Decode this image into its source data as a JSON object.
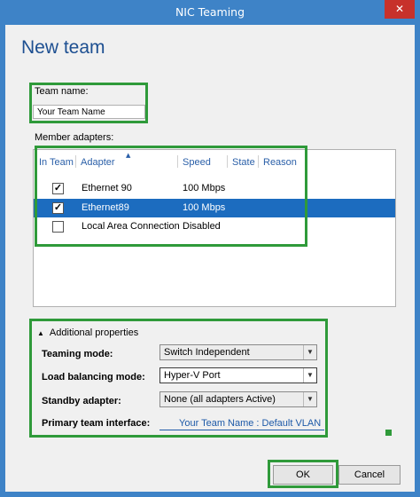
{
  "window": {
    "title": "NIC Teaming",
    "close_glyph": "✕"
  },
  "page": {
    "title": "New team"
  },
  "team_name": {
    "label": "Team name:",
    "value": "Your Team Name"
  },
  "member_adapters": {
    "label": "Member adapters:",
    "sort_glyph": "▲",
    "columns": [
      "In Team",
      "Adapter",
      "Speed",
      "State",
      "Reason"
    ],
    "rows": [
      {
        "checked": true,
        "check_glyph": "✓",
        "adapter": "Ethernet 90",
        "speed": "100 Mbps",
        "selected": false
      },
      {
        "checked": true,
        "check_glyph": "✓",
        "adapter": "Ethernet89",
        "speed": "100 Mbps",
        "selected": true
      },
      {
        "checked": false,
        "check_glyph": "",
        "adapter": "Local Area Connection",
        "speed": "Disabled",
        "selected": false
      }
    ]
  },
  "additional_properties": {
    "toggle_glyph": "▲",
    "label": "Additional properties",
    "teaming_mode": {
      "label": "Teaming mode:",
      "value": "Switch Independent"
    },
    "load_balancing_mode": {
      "label": "Load balancing mode:",
      "value": "Hyper-V Port"
    },
    "standby_adapter": {
      "label": "Standby adapter:",
      "value": "None (all adapters Active)"
    },
    "primary_team_interface": {
      "label": "Primary team interface:",
      "value": "Your Team Name   : Default VLAN"
    },
    "dropdown_glyph": "▼"
  },
  "buttons": {
    "ok": "OK",
    "cancel": "Cancel"
  },
  "colors": {
    "accent": "#3e83c7",
    "highlight_green": "#2f9a3a",
    "selection": "#1c6cbf",
    "title_blue": "#1d4f91"
  }
}
